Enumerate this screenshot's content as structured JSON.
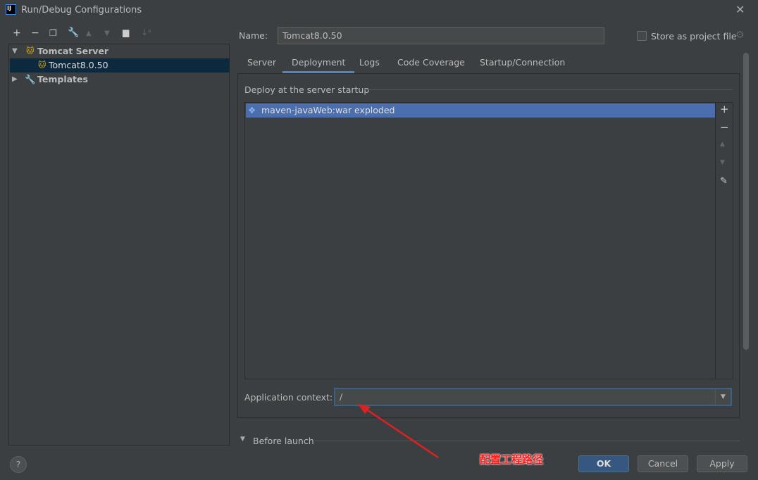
{
  "window": {
    "title": "Run/Debug Configurations",
    "logo": "IJ"
  },
  "toolbar": {
    "icons": [
      "plus-icon",
      "minus-icon",
      "copy-icon",
      "wrench-icon",
      "arrow-up-icon",
      "arrow-down-icon",
      "new-folder-icon",
      "sort-icon"
    ]
  },
  "tree": {
    "items": [
      {
        "label": "Tomcat Server",
        "expanded": true
      },
      {
        "label": "Tomcat8.0.50",
        "selected": true
      },
      {
        "label": "Templates",
        "expanded": false
      }
    ]
  },
  "name": {
    "label": "Name:",
    "value": "Tomcat8.0.50"
  },
  "store": {
    "label": "Store as project file",
    "checked": false
  },
  "tabs": [
    {
      "label": "Server"
    },
    {
      "label": "Deployment",
      "active": true
    },
    {
      "label": "Logs"
    },
    {
      "label": "Code Coverage"
    },
    {
      "label": "Startup/Connection"
    }
  ],
  "deploy": {
    "section": "Deploy at the server startup",
    "items": [
      "maven-javaWeb:war exploded"
    ]
  },
  "context": {
    "label": "Application context:",
    "value": "/"
  },
  "before_launch": {
    "label": "Before launch"
  },
  "buttons": {
    "ok": "OK",
    "cancel": "Cancel",
    "apply": "Apply"
  },
  "annotation": {
    "text": "配置工程路径",
    "color": "#ff1a1a"
  },
  "colors": {
    "selection": "#4b6eaf",
    "accent": "#4a88c7",
    "background": "#3c3f41"
  }
}
